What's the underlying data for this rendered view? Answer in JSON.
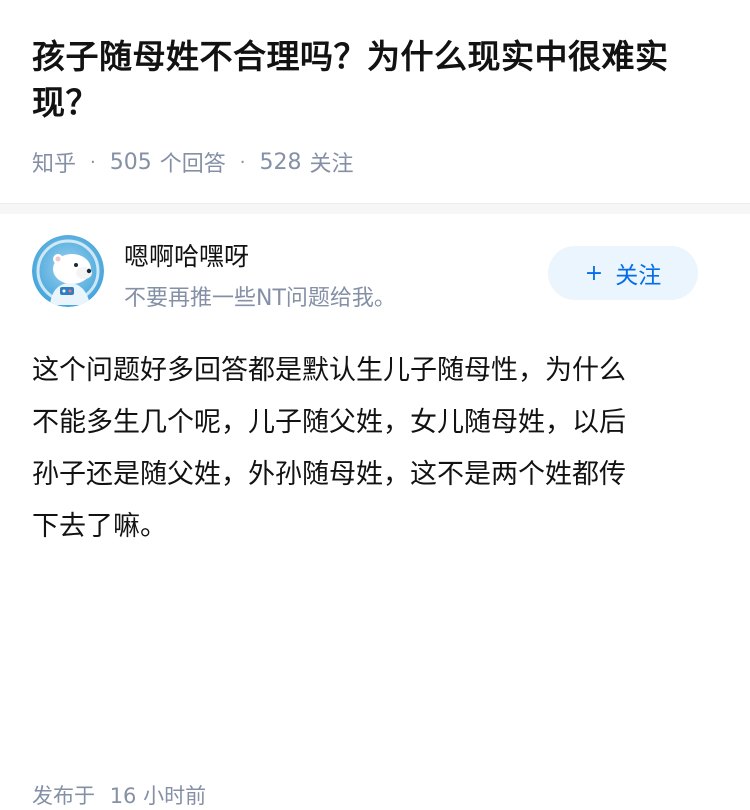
{
  "question": {
    "title_line1": "孩子随母姓不合理吗？为什么现实中很难实",
    "title_line2": "现？",
    "source": "知乎",
    "answers_count": "505",
    "answers_label": "个回答",
    "followers_count": "528",
    "followers_label": "关注"
  },
  "answer": {
    "author": {
      "name": "嗯啊哈嘿呀",
      "bio": "不要再推一些NT问题给我。",
      "avatar_icon": "polar-bear-astronaut-avatar"
    },
    "follow_button": {
      "plus": "+",
      "label": "关注"
    },
    "content_lines": [
      "这个问题好多回答都是默认生儿子随母性，为什么",
      "不能多生几个呢，儿子随父姓，女儿随母姓，以后",
      "孙子还是随父姓，外孙随母姓，这不是两个姓都传",
      "下去了嘛。"
    ],
    "published_label": "发布于",
    "published_time": "16 小时前"
  },
  "colors": {
    "title": "#121212",
    "meta": "#8590a6",
    "accent": "#056de8",
    "follow_bg": "#ebf5fd"
  }
}
